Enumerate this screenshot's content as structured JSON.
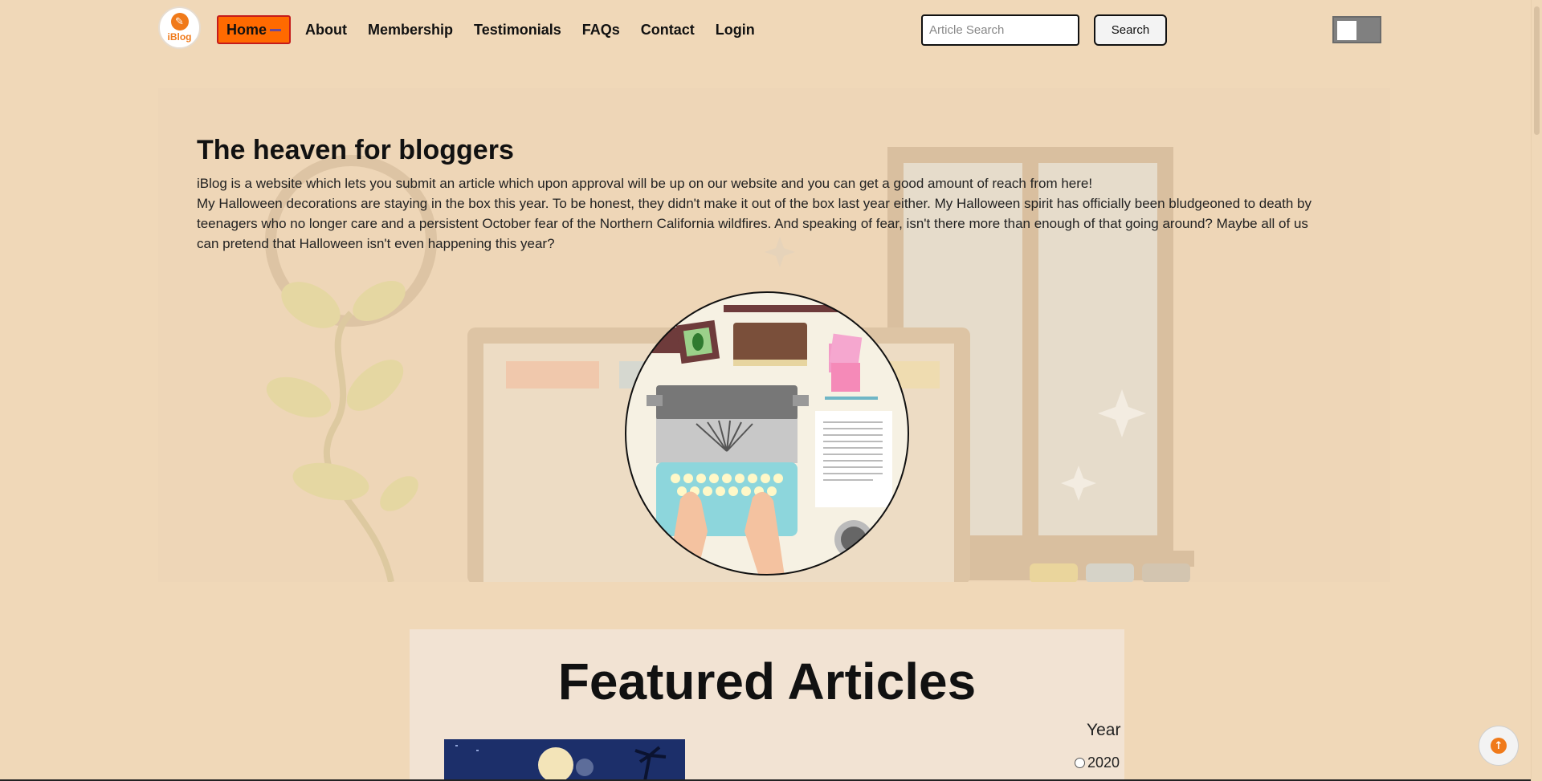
{
  "nav": {
    "logo_text": "iBlog",
    "links": [
      {
        "label": "Home",
        "active": true
      },
      {
        "label": "About"
      },
      {
        "label": "Membership"
      },
      {
        "label": "Testimonials"
      },
      {
        "label": "FAQs"
      },
      {
        "label": "Contact"
      },
      {
        "label": "Login"
      }
    ],
    "search_placeholder": "Article Search",
    "search_button": "Search"
  },
  "hero": {
    "title": "The heaven for bloggers",
    "paragraph_1": "iBlog is a website which lets you submit an article which upon approval will be up on our website and you can get a good amount of reach from here!",
    "paragraph_2": "My Halloween decorations are staying in the box this year. To be honest, they didn't make it out of the box last year either. My Halloween spirit has officially been bludgeoned to death by teenagers who no longer care and a persistent October fear of the Northern California wildfires. And speaking of fear, isn't there more than enough of that going around? Maybe all of us can pretend that Halloween isn't even happening this year?"
  },
  "featured": {
    "title": "Featured Articles",
    "filter_label": "Year",
    "year_options": [
      "2020"
    ]
  },
  "colors": {
    "page_bg": "#f0d8b8",
    "accent": "#ff6a00",
    "active_border": "#c51b1b"
  },
  "icons": {
    "logo": "iblog-logo-icon",
    "scroll_top": "arrow-up-icon"
  }
}
